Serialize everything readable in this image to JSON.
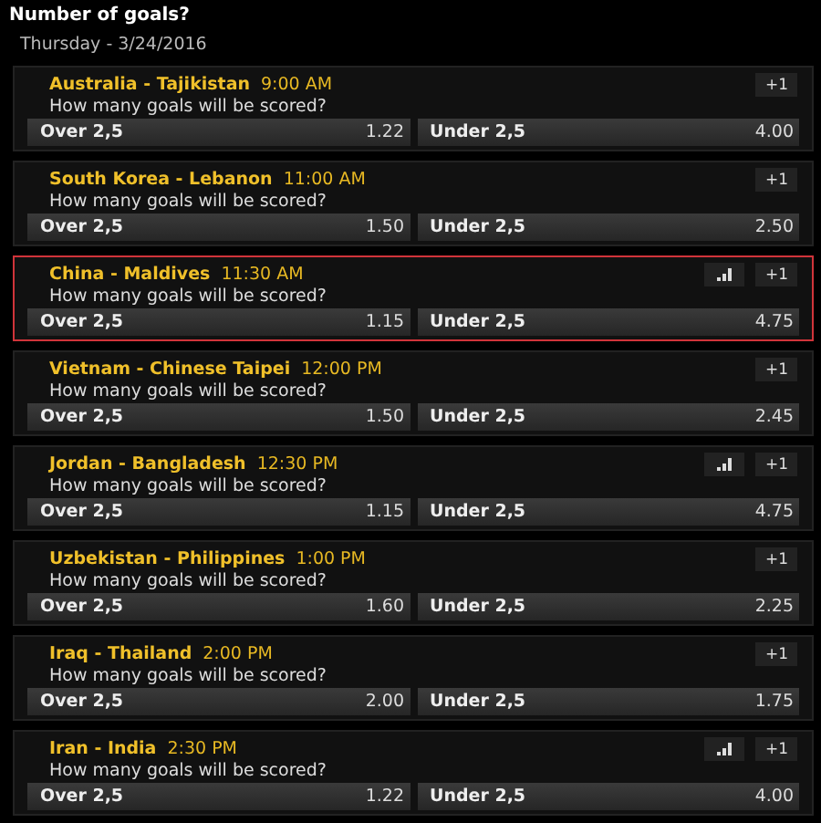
{
  "title": "Number of goals?",
  "date": "Thursday - 3/24/2016",
  "matches": [
    {
      "teams": "Australia - Tajikistan",
      "time": "9:00 AM",
      "question": "How many goals will be scored?",
      "stats": false,
      "more": "+1",
      "selected": false,
      "odds": [
        {
          "label": "Over 2,5",
          "price": "1.22"
        },
        {
          "label": "Under 2,5",
          "price": "4.00"
        }
      ]
    },
    {
      "teams": "South Korea - Lebanon",
      "time": "11:00 AM",
      "question": "How many goals will be scored?",
      "stats": false,
      "more": "+1",
      "selected": false,
      "odds": [
        {
          "label": "Over 2,5",
          "price": "1.50"
        },
        {
          "label": "Under 2,5",
          "price": "2.50"
        }
      ]
    },
    {
      "teams": "China - Maldives",
      "time": "11:30 AM",
      "question": "How many goals will be scored?",
      "stats": true,
      "more": "+1",
      "selected": true,
      "odds": [
        {
          "label": "Over 2,5",
          "price": "1.15"
        },
        {
          "label": "Under 2,5",
          "price": "4.75"
        }
      ]
    },
    {
      "teams": "Vietnam - Chinese Taipei",
      "time": "12:00 PM",
      "question": "How many goals will be scored?",
      "stats": false,
      "more": "+1",
      "selected": false,
      "odds": [
        {
          "label": "Over 2,5",
          "price": "1.50"
        },
        {
          "label": "Under 2,5",
          "price": "2.45"
        }
      ]
    },
    {
      "teams": "Jordan - Bangladesh",
      "time": "12:30 PM",
      "question": "How many goals will be scored?",
      "stats": true,
      "more": "+1",
      "selected": false,
      "odds": [
        {
          "label": "Over 2,5",
          "price": "1.15"
        },
        {
          "label": "Under 2,5",
          "price": "4.75"
        }
      ]
    },
    {
      "teams": "Uzbekistan - Philippines",
      "time": "1:00 PM",
      "question": "How many goals will be scored?",
      "stats": false,
      "more": "+1",
      "selected": false,
      "odds": [
        {
          "label": "Over 2,5",
          "price": "1.60"
        },
        {
          "label": "Under 2,5",
          "price": "2.25"
        }
      ]
    },
    {
      "teams": "Iraq - Thailand",
      "time": "2:00 PM",
      "question": "How many goals will be scored?",
      "stats": false,
      "more": "+1",
      "selected": false,
      "odds": [
        {
          "label": "Over 2,5",
          "price": "2.00"
        },
        {
          "label": "Under 2,5",
          "price": "1.75"
        }
      ]
    },
    {
      "teams": "Iran - India",
      "time": "2:30 PM",
      "question": "How many goals will be scored?",
      "stats": true,
      "more": "+1",
      "selected": false,
      "odds": [
        {
          "label": "Over 2,5",
          "price": "1.22"
        },
        {
          "label": "Under 2,5",
          "price": "4.00"
        }
      ]
    }
  ]
}
